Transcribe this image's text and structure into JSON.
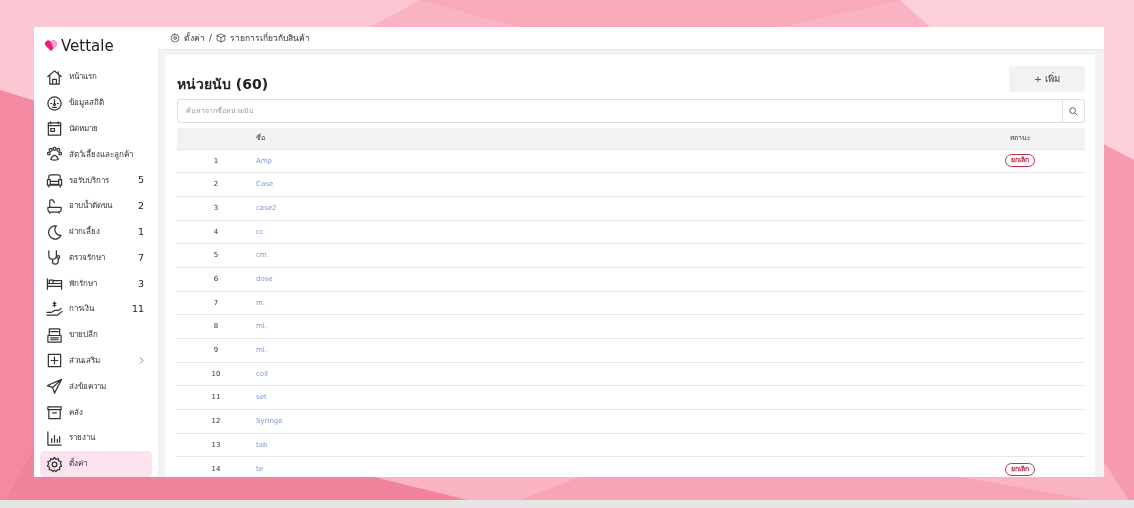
{
  "app": {
    "logo": "Vettale"
  },
  "sidebar": {
    "items": [
      {
        "label": "หน้าแรก",
        "selected": false
      },
      {
        "label": "ข้อมูลสถิติ",
        "selected": false
      },
      {
        "label": "นัดหมาย",
        "selected": false
      },
      {
        "label": "สัตว์เลี้ยงและลูกค้า",
        "selected": false
      },
      {
        "label": "รอรับบริการ",
        "count": "5",
        "selected": false
      },
      {
        "label": "อาบน้ำตัดขน",
        "count": "2",
        "selected": false
      },
      {
        "label": "ฝากเลี้ยง",
        "count": "1",
        "selected": false
      },
      {
        "label": "ตรวจรักษา",
        "count": "7",
        "selected": false
      },
      {
        "label": "พักรักษา",
        "count": "3",
        "selected": false
      },
      {
        "label": "การเงิน",
        "count": "11",
        "selected": false
      },
      {
        "label": "ขายปลีก",
        "selected": false
      },
      {
        "label": "ส่วนเสริม",
        "has_submenu": true,
        "selected": false
      },
      {
        "label": "ส่งข้อความ",
        "selected": false
      },
      {
        "label": "คลัง",
        "selected": false
      },
      {
        "label": "รายงาน",
        "selected": false
      },
      {
        "label": "ตั้งค่า",
        "selected": true
      }
    ]
  },
  "breadcrumb": [
    "ตั้งค่า",
    "/",
    "รายการเกี่ยวกับสินค้า"
  ],
  "page": {
    "title": "หน่วยนับ (60)",
    "add_button": "+ เพิ่ม",
    "search": {
      "placeholder": "ค้นหาจากชื่อหน่วยนับ"
    }
  },
  "table": {
    "columns": [
      "ชื่อ",
      "สถานะ"
    ],
    "rows": [
      {
        "no": "1",
        "name": "Amp",
        "status": "ยกเลิก"
      },
      {
        "no": "2",
        "name": "Case"
      },
      {
        "no": "3",
        "name": "case2"
      },
      {
        "no": "4",
        "name": "cc"
      },
      {
        "no": "5",
        "name": "cm."
      },
      {
        "no": "6",
        "name": "dose"
      },
      {
        "no": "7",
        "name": "m."
      },
      {
        "no": "8",
        "name": "ml."
      },
      {
        "no": "9",
        "name": "ml."
      },
      {
        "no": "10",
        "name": "coll"
      },
      {
        "no": "11",
        "name": "set"
      },
      {
        "no": "12",
        "name": "Syringe"
      },
      {
        "no": "13",
        "name": "tab"
      },
      {
        "no": "14",
        "name": "te",
        "status": "ยกเลิก"
      }
    ]
  }
}
